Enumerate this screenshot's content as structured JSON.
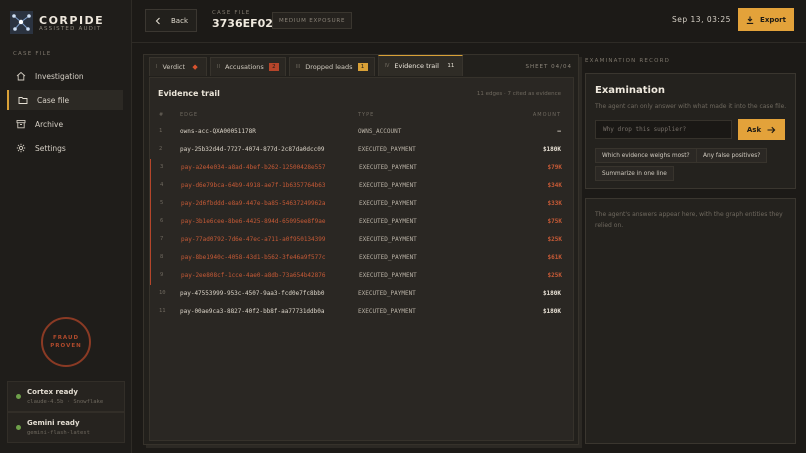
{
  "brand": {
    "name": "CORPIDE",
    "subtitle": "ASSISTED AUDIT"
  },
  "sidebar": {
    "section_label": "CASE FILE",
    "items": [
      {
        "label": "Investigation",
        "icon": "home-icon"
      },
      {
        "label": "Case file",
        "icon": "folder-icon",
        "active": true
      },
      {
        "label": "Archive",
        "icon": "archive-icon"
      },
      {
        "label": "Settings",
        "icon": "gear-icon"
      }
    ],
    "stamp": {
      "line1": "FRAUD",
      "line2": "PROVEN"
    },
    "status": [
      {
        "title": "Cortex ready",
        "detail": "claude-4.5b · Snowflake"
      },
      {
        "title": "Gemini ready",
        "detail": "gemini-flash-latest"
      }
    ]
  },
  "header": {
    "back_label": "Back",
    "case_file_label": "CASE FILE",
    "case_id": "3736EF02",
    "exposure": "MEDIUM EXPOSURE",
    "datetime": "Sep 13, 03:25",
    "export_label": "Export"
  },
  "tabs": [
    {
      "num": "I",
      "label": "Verdict",
      "badge": "◆",
      "badge_color": "#d9532f"
    },
    {
      "num": "II",
      "label": "Accusations",
      "badge": "2",
      "badge_color": "#b5452a"
    },
    {
      "num": "III",
      "label": "Dropped leads",
      "badge": "1",
      "badge_color": "#d9a137"
    },
    {
      "num": "IV",
      "label": "Evidence trail",
      "badge": "11",
      "active": true
    }
  ],
  "sheet_label": "SHEET 04/04",
  "evidence": {
    "title": "Evidence trail",
    "meta": "11 edges · 7 cited as evidence",
    "columns": {
      "num": "#",
      "edge": "EDGE",
      "type": "TYPE",
      "amount": "AMOUNT"
    },
    "rows": [
      {
        "n": "1",
        "edge": "owns-acc-QXA00051178R",
        "type": "OWNS_ACCOUNT",
        "amount": "—",
        "cited": false
      },
      {
        "n": "2",
        "edge": "pay-25b32d4d-7727-4074-877d-2c87da0dcc09",
        "type": "EXECUTED_PAYMENT",
        "amount": "$180K",
        "cited": false
      },
      {
        "n": "3",
        "edge": "pay-a2e4e034-a8ad-4bef-b262-12500428e557",
        "type": "EXECUTED_PAYMENT",
        "amount": "$79K",
        "cited": true
      },
      {
        "n": "4",
        "edge": "pay-d6e79bca-64b9-4918-ae7f-1b6357764b63",
        "type": "EXECUTED_PAYMENT",
        "amount": "$34K",
        "cited": true
      },
      {
        "n": "5",
        "edge": "pay-2d6fbddd-e8a9-447e-ba85-54637249962a",
        "type": "EXECUTED_PAYMENT",
        "amount": "$33K",
        "cited": true
      },
      {
        "n": "6",
        "edge": "pay-3b1e6cee-8be6-4425-894d-65095ee8f9ae",
        "type": "EXECUTED_PAYMENT",
        "amount": "$75K",
        "cited": true
      },
      {
        "n": "7",
        "edge": "pay-77ad0792-7d6e-47ec-a711-a0f950134399",
        "type": "EXECUTED_PAYMENT",
        "amount": "$25K",
        "cited": true
      },
      {
        "n": "8",
        "edge": "pay-8be1940c-4058-43d1-b562-3fe46a9f577c",
        "type": "EXECUTED_PAYMENT",
        "amount": "$61K",
        "cited": true
      },
      {
        "n": "9",
        "edge": "pay-2ee808cf-1cce-4ae0-a8db-73a654b42876",
        "type": "EXECUTED_PAYMENT",
        "amount": "$25K",
        "cited": true
      },
      {
        "n": "10",
        "edge": "pay-47553999-953c-4507-9aa3-fcd0e7fc8bb0",
        "type": "EXECUTED_PAYMENT",
        "amount": "$180K",
        "cited": false
      },
      {
        "n": "11",
        "edge": "pay-00ae9ca3-8827-40f2-bb8f-aa77731ddb0a",
        "type": "EXECUTED_PAYMENT",
        "amount": "$180K",
        "cited": false
      }
    ]
  },
  "exam": {
    "section_label": "EXAMINATION RECORD",
    "title": "Examination",
    "subtitle": "The agent can only answer with what made it into the case file.",
    "input_placeholder": "Why drop this supplier?",
    "ask_label": "Ask",
    "chips": [
      "Which evidence weighs most?",
      "Any false positives?",
      "Summarize in one line"
    ],
    "answers_hint": "The agent's answers appear here, with the graph entities they relied on."
  },
  "colors": {
    "accent": "#e3a23a",
    "cited": "#c65a36",
    "ready": "#6ea04a"
  }
}
